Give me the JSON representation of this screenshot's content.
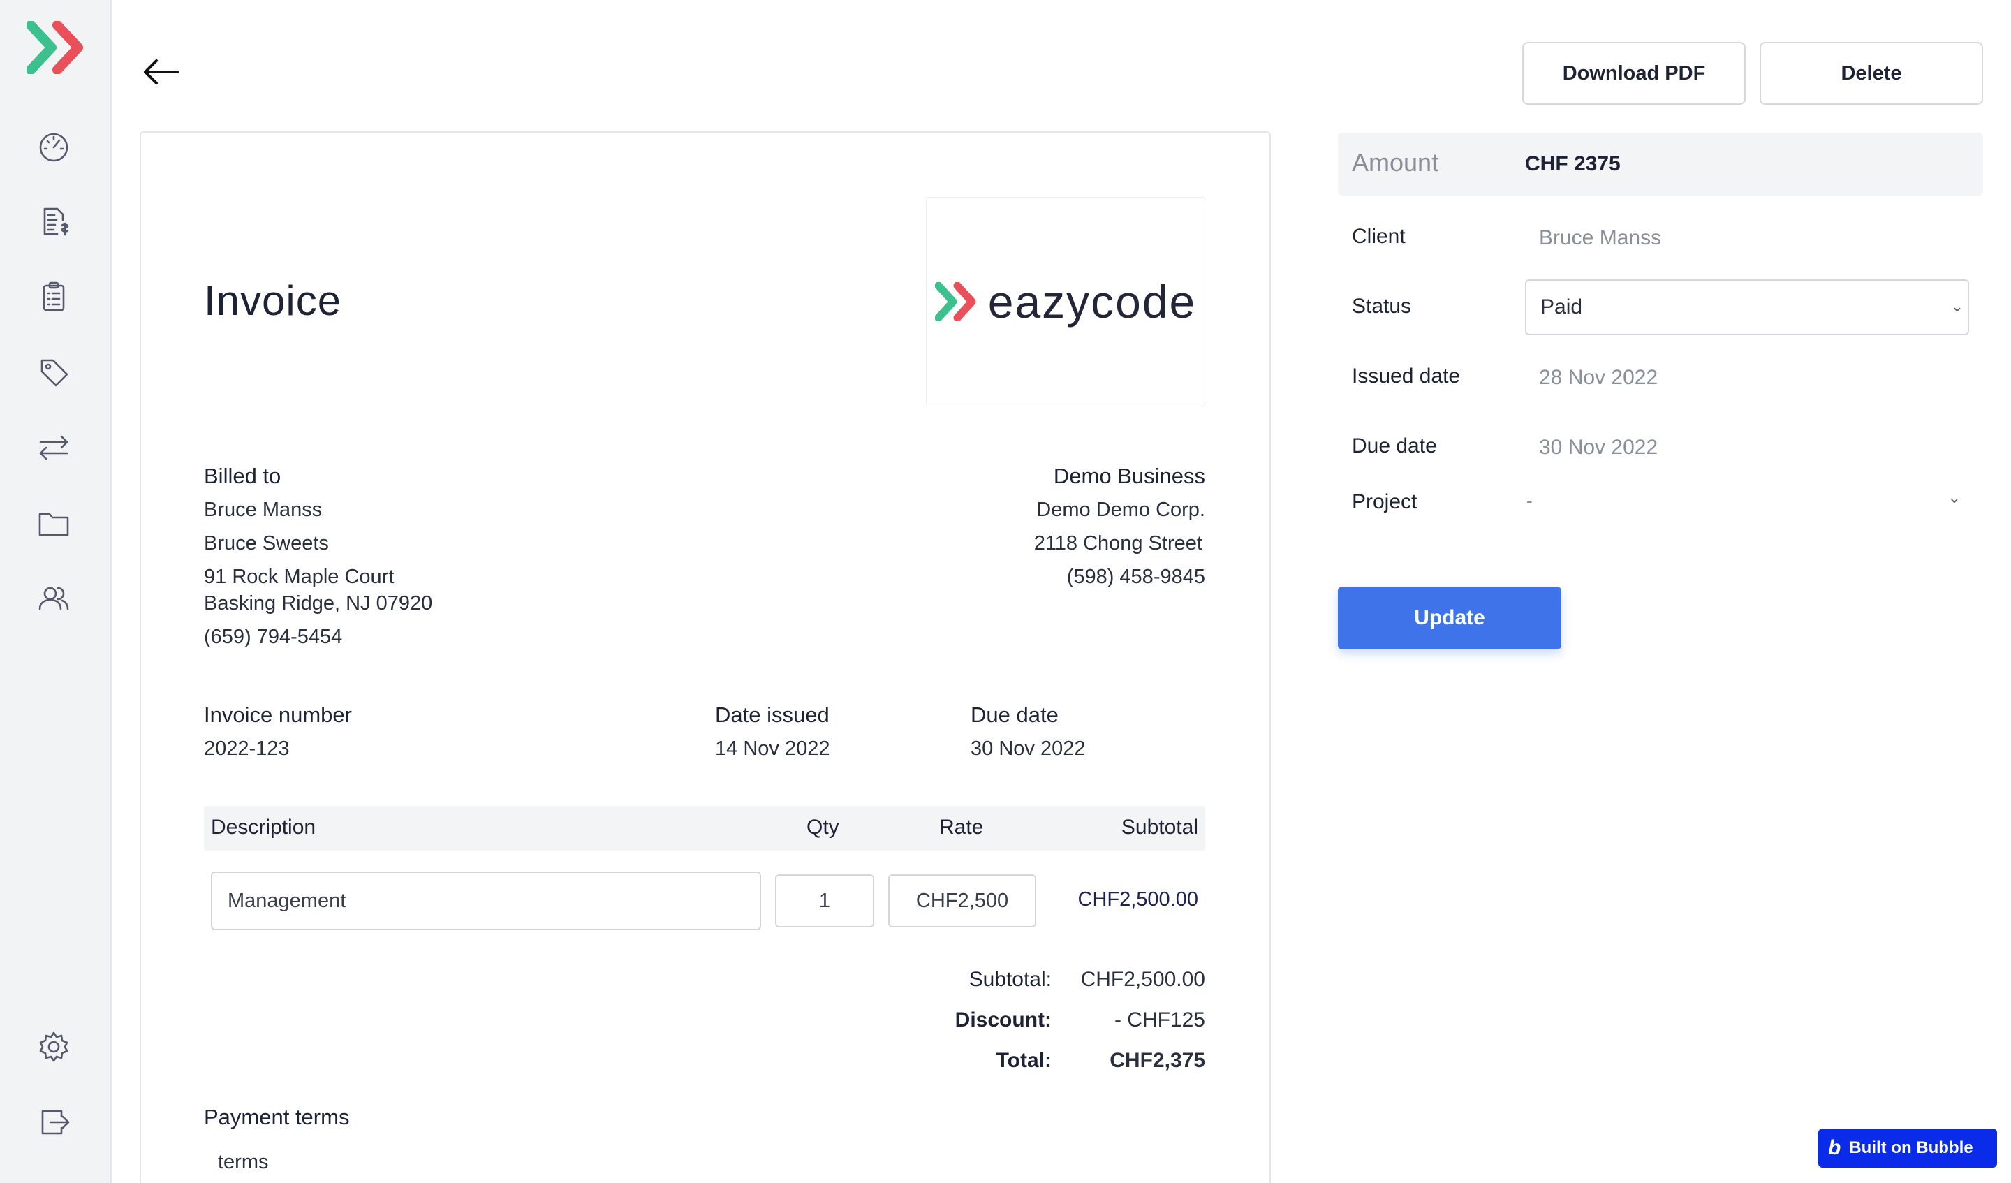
{
  "sidebar": {
    "items": [
      {
        "name": "dashboard"
      },
      {
        "name": "invoices"
      },
      {
        "name": "tasks"
      },
      {
        "name": "tags"
      },
      {
        "name": "transactions"
      },
      {
        "name": "projects"
      },
      {
        "name": "clients"
      },
      {
        "name": "settings"
      },
      {
        "name": "logout"
      }
    ]
  },
  "toolbar": {
    "download_label": "Download PDF",
    "delete_label": "Delete"
  },
  "invoice": {
    "title": "Invoice",
    "logo_text": "eazycode",
    "billed_to_label": "Billed to",
    "client_name": "Bruce Manss",
    "client_company": "Bruce Sweets",
    "client_address1": "91 Rock Maple Court",
    "client_address2": "Basking Ridge, NJ 07920",
    "client_phone": "(659) 794-5454",
    "business_name": "Demo Business",
    "business_company": "Demo Demo Corp.",
    "business_address": "2118 Chong Street",
    "business_phone": "(598) 458-9845",
    "number_label": "Invoice number",
    "number": "2022-123",
    "issued_label": "Date issued",
    "issued": "14 Nov 2022",
    "due_label": "Due date",
    "due": "30 Nov 2022",
    "columns": {
      "description": "Description",
      "qty": "Qty",
      "rate": "Rate",
      "subtotal": "Subtotal"
    },
    "line": {
      "description": "Management",
      "qty": "1",
      "rate": "CHF2,500",
      "subtotal": "CHF2,500.00"
    },
    "subtotal_label": "Subtotal:",
    "subtotal": "CHF2,500.00",
    "discount_label": "Discount:",
    "discount": "- CHF125",
    "total_label": "Total:",
    "total": "CHF2,375",
    "payment_terms_label": "Payment terms",
    "payment_terms": "terms"
  },
  "details": {
    "amount_label": "Amount",
    "amount": "CHF 2375",
    "client_label": "Client",
    "client": "Bruce Manss",
    "status_label": "Status",
    "status": "Paid",
    "issued_label": "Issued date",
    "issued": "28 Nov 2022",
    "due_label": "Due date",
    "due": "30 Nov 2022",
    "project_label": "Project",
    "project": "-",
    "update_label": "Update"
  },
  "badge": {
    "label": "Built on Bubble"
  },
  "colors": {
    "accent": "#3f73ea",
    "bubble": "#0a2be8"
  }
}
